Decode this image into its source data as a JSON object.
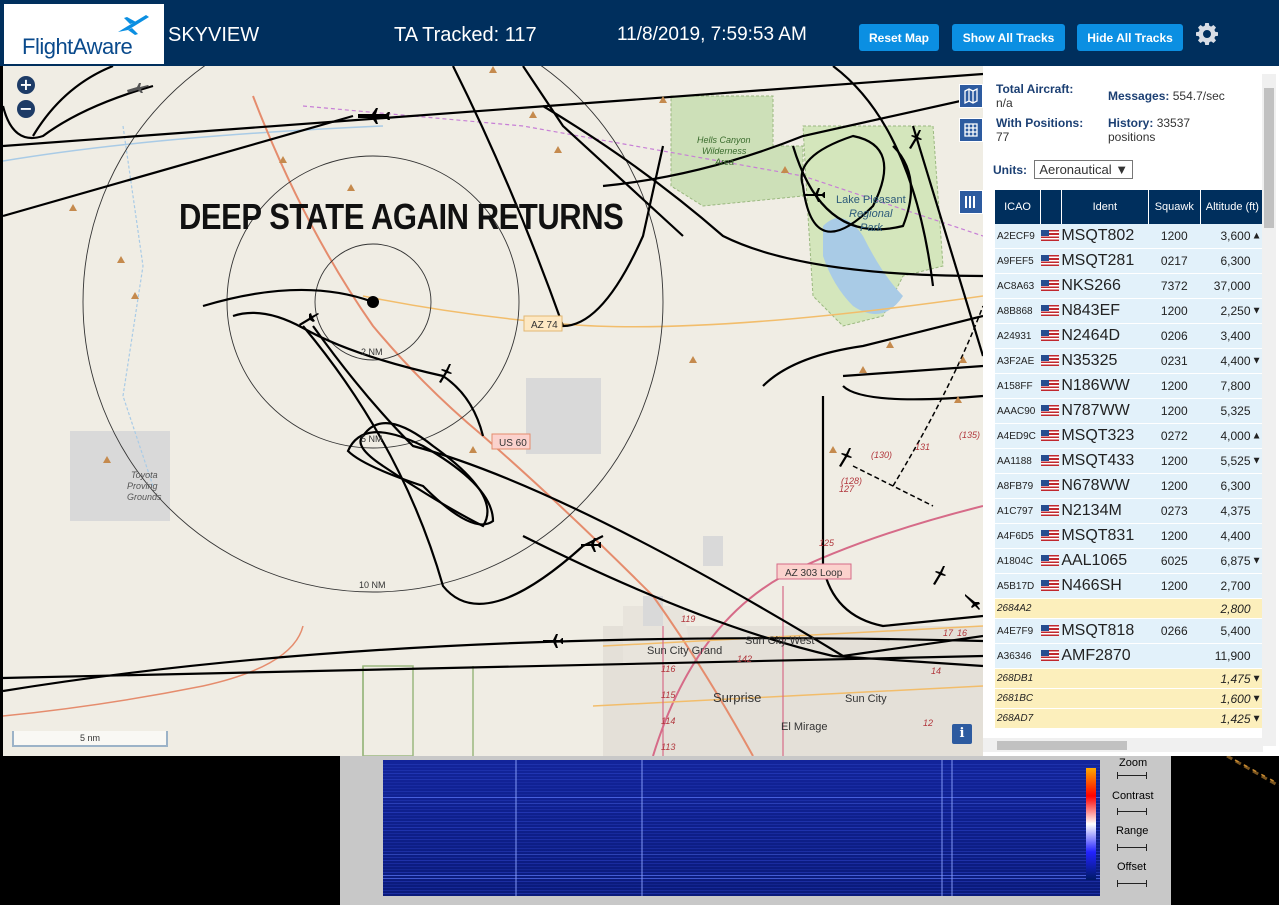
{
  "header": {
    "logo_text": "FlightAware",
    "app_title": "SKYVIEW",
    "tracked": "TA Tracked: 117",
    "clock": "11/8/2019, 7:59:53 AM",
    "buttons": {
      "reset": "Reset Map",
      "show_all": "Show All Tracks",
      "hide_all": "Hide All Tracks"
    },
    "icons": {
      "settings": "gear-icon",
      "logo": "plane-icon"
    }
  },
  "map": {
    "overlay_caption": "DEEP STATE AGAIN RETURNS",
    "zoom_in": "+",
    "zoom_out": "−",
    "range_rings": [
      "2 NM",
      "5 NM",
      "10 NM"
    ],
    "roads": [
      "AZ 74",
      "US 60",
      "AZ 303 Loop"
    ],
    "places": [
      "Hells Canyon Wilderness Area",
      "Lake Pleasant Regional Park",
      "Toyota Proving Grounds",
      "Sun City Grand",
      "Sun City West",
      "Surprise",
      "Sun City",
      "El Mirage"
    ],
    "route_numbers": [
      "131",
      "(135)",
      "(130)",
      "(128)",
      "127",
      "125",
      "119",
      "116",
      "115",
      "114",
      "113",
      "142",
      "14",
      "12",
      "17",
      "16"
    ],
    "scale_label": "5 nm",
    "info_label": "i"
  },
  "sidebar": {
    "total_aircraft_label": "Total Aircraft:",
    "total_aircraft_value": "n/a",
    "with_positions_label": "With Positions:",
    "with_positions_value": "77",
    "messages_label": "Messages:",
    "messages_value": "554.7/sec",
    "history_label": "History:",
    "history_value": "33537",
    "history_unit": "positions",
    "units_label": "Units:",
    "units_value": "Aeronautical ▼",
    "columns": [
      "ICAO",
      "",
      "Ident",
      "Squawk",
      "Altitude (ft)"
    ],
    "rows": [
      {
        "icao": "A2ECF9",
        "flag": true,
        "ident": "MSQT802",
        "squawk": "1200",
        "alt": "3,600",
        "trend": "▲"
      },
      {
        "icao": "A9FEF5",
        "flag": true,
        "ident": "MSQT281",
        "squawk": "0217",
        "alt": "6,300",
        "trend": ""
      },
      {
        "icao": "AC8A63",
        "flag": true,
        "ident": "NKS266",
        "squawk": "7372",
        "alt": "37,000",
        "trend": ""
      },
      {
        "icao": "A8B868",
        "flag": true,
        "ident": "N843EF",
        "squawk": "1200",
        "alt": "2,250",
        "trend": "▼"
      },
      {
        "icao": "A24931",
        "flag": true,
        "ident": "N2464D",
        "squawk": "0206",
        "alt": "3,400",
        "trend": ""
      },
      {
        "icao": "A3F2AE",
        "flag": true,
        "ident": "N35325",
        "squawk": "0231",
        "alt": "4,400",
        "trend": "▼"
      },
      {
        "icao": "A158FF",
        "flag": true,
        "ident": "N186WW",
        "squawk": "1200",
        "alt": "7,800",
        "trend": ""
      },
      {
        "icao": "AAAC90",
        "flag": true,
        "ident": "N787WW",
        "squawk": "1200",
        "alt": "5,325",
        "trend": ""
      },
      {
        "icao": "A4ED9C",
        "flag": true,
        "ident": "MSQT323",
        "squawk": "0272",
        "alt": "4,000",
        "trend": "▲"
      },
      {
        "icao": "AA1188",
        "flag": true,
        "ident": "MSQT433",
        "squawk": "1200",
        "alt": "5,525",
        "trend": "▼"
      },
      {
        "icao": "A8FB79",
        "flag": true,
        "ident": "N678WW",
        "squawk": "1200",
        "alt": "6,300",
        "trend": ""
      },
      {
        "icao": "A1C797",
        "flag": true,
        "ident": "N2134M",
        "squawk": "0273",
        "alt": "4,375",
        "trend": ""
      },
      {
        "icao": "A4F6D5",
        "flag": true,
        "ident": "MSQT831",
        "squawk": "1200",
        "alt": "4,400",
        "trend": ""
      },
      {
        "icao": "A1804C",
        "flag": true,
        "ident": "AAL1065",
        "squawk": "6025",
        "alt": "6,875",
        "trend": "▼"
      },
      {
        "icao": "A5B17D",
        "flag": true,
        "ident": "N466SH",
        "squawk": "1200",
        "alt": "2,700",
        "trend": ""
      },
      {
        "icao": "2684A2",
        "flag": false,
        "ident": "",
        "squawk": "",
        "alt": "2,800",
        "trend": "",
        "mlat": true
      },
      {
        "icao": "A4E7F9",
        "flag": true,
        "ident": "MSQT818",
        "squawk": "0266",
        "alt": "5,400",
        "trend": ""
      },
      {
        "icao": "A36346",
        "flag": true,
        "ident": "AMF2870",
        "squawk": "",
        "alt": "11,900",
        "trend": ""
      },
      {
        "icao": "268DB1",
        "flag": false,
        "ident": "",
        "squawk": "",
        "alt": "1,475",
        "trend": "▼",
        "mlat": true
      },
      {
        "icao": "2681BC",
        "flag": false,
        "ident": "",
        "squawk": "",
        "alt": "1,600",
        "trend": "▼",
        "mlat": true
      },
      {
        "icao": "268AD7",
        "flag": false,
        "ident": "",
        "squawk": "",
        "alt": "1,425",
        "trend": "▼",
        "mlat": true
      }
    ]
  },
  "waterfall": {
    "labels": {
      "zoom": "Zoom",
      "contrast": "Contrast",
      "range": "Range",
      "offset": "Offset"
    }
  }
}
